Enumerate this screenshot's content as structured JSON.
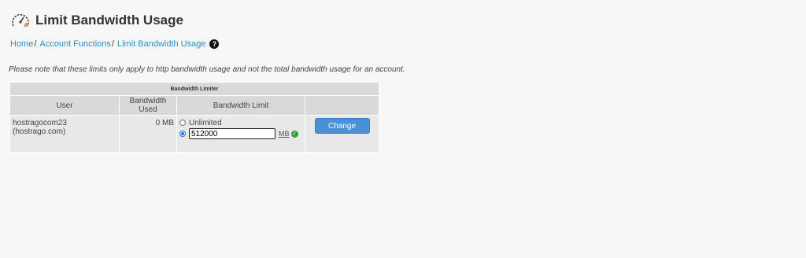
{
  "page": {
    "title": "Limit Bandwidth Usage",
    "icon": "gauge-icon"
  },
  "breadcrumb": {
    "items": [
      "Home",
      "Account Functions",
      "Limit Bandwidth Usage"
    ],
    "separator": "/"
  },
  "note": "Please note that these limits only apply to http bandwidth usage and not the total bandwidth usage for an account.",
  "table": {
    "title": "Bandwidth Limiter",
    "headers": [
      "User",
      "Bandwidth Used",
      "Bandwidth Limit",
      ""
    ],
    "row": {
      "user": "hostragocom23 (hostrago.com)",
      "used": "0 MB",
      "unlimited_label": "Unlimited",
      "limit_value": "512000",
      "unit": "MB",
      "selected_option": "limit"
    },
    "button_label": "Change"
  },
  "colors": {
    "link": "#2b8ec4",
    "button": "#4a90d6",
    "header_bg": "#d9d9d9",
    "cell_bg": "#e8e8e8",
    "ok": "#3a9a3a"
  }
}
